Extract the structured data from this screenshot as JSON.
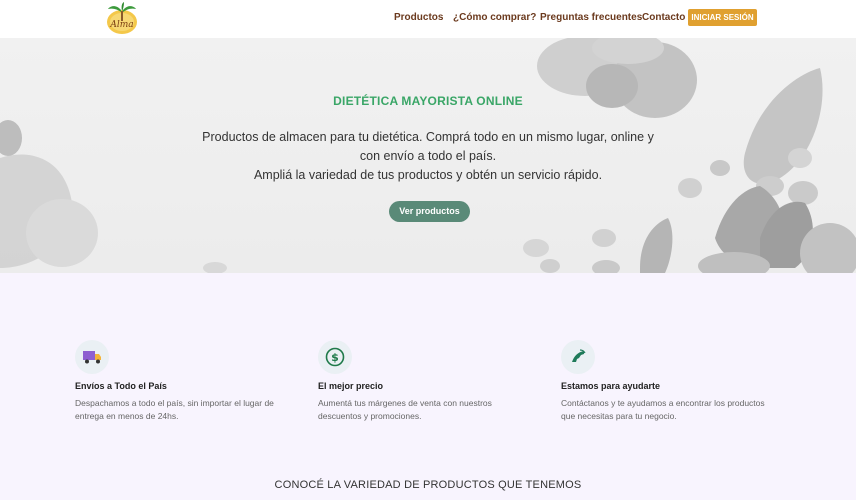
{
  "header": {
    "logo_text": "Alma",
    "nav": [
      "Productos",
      "¿Cómo comprar?",
      "Preguntas frecuentes",
      "Contacto"
    ],
    "login_label": "INICIAR SESIÓN"
  },
  "hero": {
    "title": "DIETÉTICA MAYORISTA ONLINE",
    "line1": "Productos de almacen para tu dietética. Comprá todo en un mismo lugar, online y con envío a todo el país.",
    "line2": "Ampliá la variedad de tus productos y obtén un servicio rápido.",
    "cta_label": "Ver productos"
  },
  "features": [
    {
      "icon": "truck-icon",
      "title": "Envíos a Todo el País",
      "text": "Despachamos a todo el país, sin importar el lugar de entrega en menos de 24hs."
    },
    {
      "icon": "dollar-icon",
      "title": "El mejor precio",
      "text": "Aumentá tus márgenes de venta con nuestros descuentos y promociones."
    },
    {
      "icon": "phone-icon",
      "title": "Estamos para ayudarte",
      "text": "Contáctanos y te ayudamos a encontrar los productos que necesitas para tu negocio."
    }
  ],
  "section": {
    "title": "CONOCÉ LA VARIEDAD DE PRODUCTOS QUE TENEMOS"
  },
  "colors": {
    "accent_green": "#3aa667",
    "button_teal": "#5a8a78",
    "login_orange": "#e0a030",
    "nav_brown": "#6b3a1e"
  }
}
